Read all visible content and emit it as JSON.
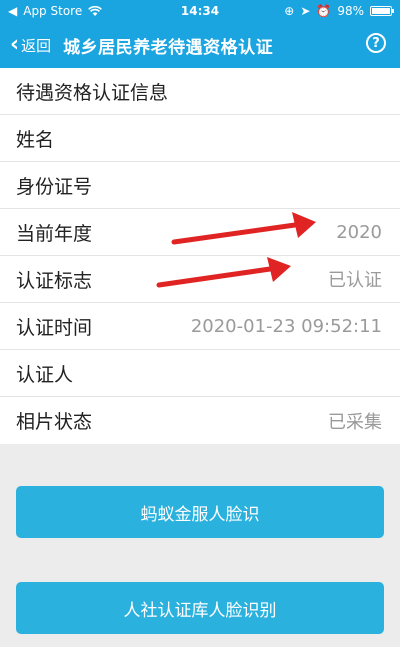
{
  "status_bar": {
    "carrier": "App Store",
    "time": "14:34",
    "battery": "98%",
    "battery_level": 0.98
  },
  "nav": {
    "back_label": "返回",
    "title": "城乡居民养老待遇资格认证",
    "help_icon": "?"
  },
  "info": {
    "section_title": "待遇资格认证信息",
    "rows": [
      {
        "label": "姓名",
        "value": ""
      },
      {
        "label": "身份证号",
        "value": ""
      },
      {
        "label": "当前年度",
        "value": "2020"
      },
      {
        "label": "认证标志",
        "value": "已认证"
      },
      {
        "label": "认证时间",
        "value": "2020-01-23 09:52:11"
      },
      {
        "label": "认证人",
        "value": ""
      },
      {
        "label": "相片状态",
        "value": "已采集"
      }
    ]
  },
  "buttons": {
    "ant_face": "蚂蚁金服人脸识",
    "social_face": "人社认证库人脸识别"
  },
  "colors": {
    "brand": "#1aa4e0",
    "button": "#2ab1de",
    "annotation_arrow": "#e02424"
  }
}
